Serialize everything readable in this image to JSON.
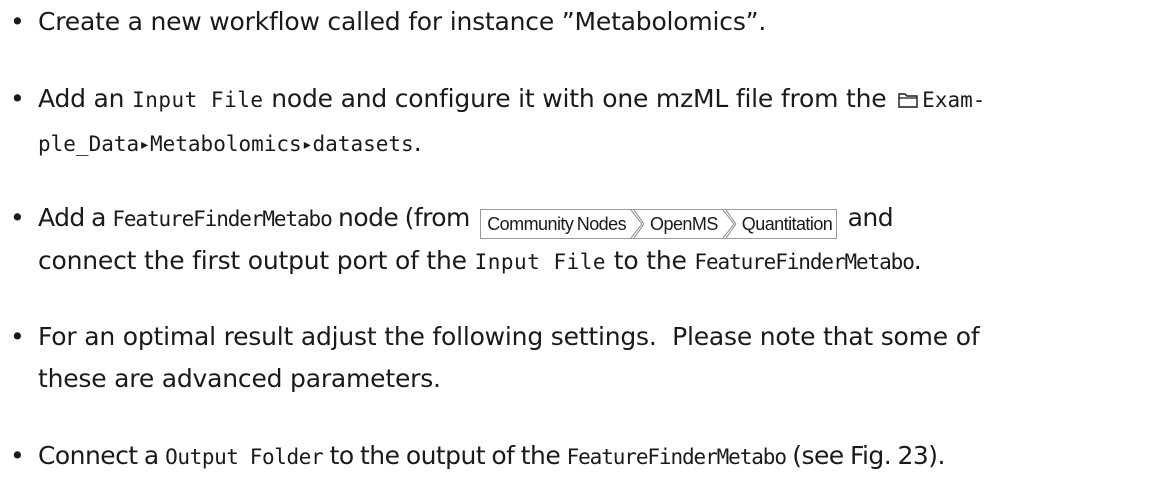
{
  "bullet_char": "•",
  "items": [
    {
      "text1": "Create a new workflow called for instance ”Metabolomics”."
    },
    {
      "text1": "Add an ",
      "code1": "Input File",
      "text2": " node and configure it with one mzML file from the ",
      "folder_icon": "folder-icon",
      "code2": "Exam-",
      "line2_code1": "ple_Data",
      "line2_code2": "Metabolomics",
      "line2_code3": "datasets",
      "line2_text": ".",
      "separator": "▸"
    },
    {
      "text1": "Add a ",
      "code1": "FeatureFinderMetabo",
      "text2": " node (from ",
      "crumbs": [
        "Community Nodes",
        "OpenMS",
        "Quantitation"
      ],
      "text3": " and",
      "line2_text1": "connect the first output port of the ",
      "line2_code1": "Input File",
      "line2_text2": " to the ",
      "line2_code2": "FeatureFinderMetabo",
      "line2_text3": "."
    },
    {
      "text1": "For an optimal result adjust the following settings.  Please note that some of",
      "line2_text": "these are advanced parameters."
    },
    {
      "text1": "Connect a ",
      "code1": "Output Folder",
      "text2": " to the output of the ",
      "code2": "FeatureFinderMetabo",
      "text3": " (see Fig. 23)."
    }
  ]
}
